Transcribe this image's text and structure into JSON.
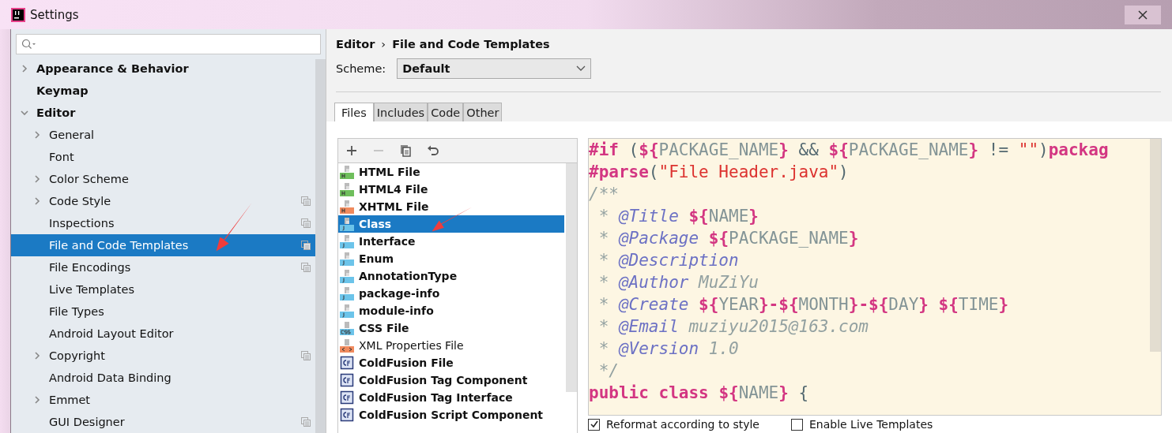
{
  "window": {
    "title": "Settings"
  },
  "sidebar": {
    "items": [
      {
        "label": "Appearance & Behavior",
        "expanded": false,
        "selected": false,
        "project_level": false
      },
      {
        "label": "Keymap",
        "selected": false,
        "project_level": false
      },
      {
        "label": "Editor",
        "expanded": true,
        "selected": false,
        "project_level": false,
        "children": [
          {
            "label": "General",
            "expanded": false,
            "selected": false,
            "project_level": false
          },
          {
            "label": "Font",
            "selected": false,
            "project_level": false
          },
          {
            "label": "Color Scheme",
            "expanded": false,
            "selected": false,
            "project_level": false
          },
          {
            "label": "Code Style",
            "expanded": false,
            "selected": false,
            "project_level": true
          },
          {
            "label": "Inspections",
            "selected": false,
            "project_level": true
          },
          {
            "label": "File and Code Templates",
            "selected": true,
            "project_level": true
          },
          {
            "label": "File Encodings",
            "selected": false,
            "project_level": true
          },
          {
            "label": "Live Templates",
            "selected": false,
            "project_level": false
          },
          {
            "label": "File Types",
            "selected": false,
            "project_level": false
          },
          {
            "label": "Android Layout Editor",
            "selected": false,
            "project_level": false
          },
          {
            "label": "Copyright",
            "expanded": false,
            "selected": false,
            "project_level": true
          },
          {
            "label": "Android Data Binding",
            "selected": false,
            "project_level": false
          },
          {
            "label": "Emmet",
            "expanded": false,
            "selected": false,
            "project_level": false
          },
          {
            "label": "GUI Designer",
            "selected": false,
            "project_level": true
          }
        ]
      }
    ]
  },
  "breadcrumb": [
    "Editor",
    "›",
    "File and Code Templates"
  ],
  "scheme": {
    "label": "Scheme:",
    "value": "Default"
  },
  "tabs": [
    {
      "label": "Files",
      "selected": true
    },
    {
      "label": "Includes",
      "selected": false
    },
    {
      "label": "Code",
      "selected": false
    },
    {
      "label": "Other",
      "selected": false
    }
  ],
  "toolbar": [
    {
      "kind": "add",
      "disabled": false
    },
    {
      "kind": "remove",
      "disabled": true
    },
    {
      "kind": "copy",
      "disabled": false
    },
    {
      "kind": "reset",
      "disabled": false
    }
  ],
  "templates": [
    {
      "name": "HTML File",
      "kind": "html",
      "customized": true,
      "selected": false
    },
    {
      "name": "HTML4 File",
      "kind": "html",
      "customized": true,
      "selected": false
    },
    {
      "name": "XHTML File",
      "kind": "xhtml",
      "customized": true,
      "selected": false
    },
    {
      "name": "Class",
      "kind": "java",
      "customized": true,
      "selected": true
    },
    {
      "name": "Interface",
      "kind": "java",
      "customized": true,
      "selected": false
    },
    {
      "name": "Enum",
      "kind": "java",
      "customized": true,
      "selected": false
    },
    {
      "name": "AnnotationType",
      "kind": "java",
      "customized": true,
      "selected": false
    },
    {
      "name": "package-info",
      "kind": "java",
      "customized": true,
      "selected": false
    },
    {
      "name": "module-info",
      "kind": "java",
      "customized": true,
      "selected": false
    },
    {
      "name": "CSS File",
      "kind": "css",
      "customized": true,
      "selected": false
    },
    {
      "name": "XML Properties File",
      "kind": "xml",
      "customized": false,
      "selected": false
    },
    {
      "name": "ColdFusion File",
      "kind": "cf",
      "customized": true,
      "selected": false
    },
    {
      "name": "ColdFusion Tag Component",
      "kind": "cf",
      "customized": true,
      "selected": false
    },
    {
      "name": "ColdFusion Tag Interface",
      "kind": "cf",
      "customized": true,
      "selected": false
    },
    {
      "name": "ColdFusion Script Component",
      "kind": "cf",
      "customized": true,
      "selected": false
    }
  ],
  "code": [
    [
      {
        "text": "#if",
        "kind": "directive"
      },
      {
        "text": " (",
        "kind": "plain"
      },
      {
        "text": "${",
        "kind": "directive"
      },
      {
        "text": "PACKAGE_NAME",
        "kind": "var"
      },
      {
        "text": "}",
        "kind": "directive"
      },
      {
        "text": " && ",
        "kind": "plain"
      },
      {
        "text": "${",
        "kind": "directive"
      },
      {
        "text": "PACKAGE_NAME",
        "kind": "var"
      },
      {
        "text": "}",
        "kind": "directive"
      },
      {
        "text": " != ",
        "kind": "plain"
      },
      {
        "text": "\"\"",
        "kind": "string"
      },
      {
        "text": ")",
        "kind": "plain"
      },
      {
        "text": "packag",
        "kind": "directive"
      }
    ],
    [
      {
        "text": "#parse",
        "kind": "directive"
      },
      {
        "text": "(",
        "kind": "plain"
      },
      {
        "text": "\"File Header.java\"",
        "kind": "string"
      },
      {
        "text": ")",
        "kind": "plain"
      }
    ],
    [
      {
        "text": "/**",
        "kind": "comment"
      }
    ],
    [
      {
        "text": " * ",
        "kind": "comment"
      },
      {
        "text": "@Title ",
        "kind": "tag"
      },
      {
        "text": "${",
        "kind": "directive"
      },
      {
        "text": "NAME",
        "kind": "var"
      },
      {
        "text": "}",
        "kind": "directive"
      }
    ],
    [
      {
        "text": " * ",
        "kind": "comment"
      },
      {
        "text": "@Package ",
        "kind": "tag"
      },
      {
        "text": "${",
        "kind": "directive"
      },
      {
        "text": "PACKAGE_NAME",
        "kind": "var"
      },
      {
        "text": "}",
        "kind": "directive"
      }
    ],
    [
      {
        "text": " * ",
        "kind": "comment"
      },
      {
        "text": "@Description",
        "kind": "tag"
      }
    ],
    [
      {
        "text": " * ",
        "kind": "comment"
      },
      {
        "text": "@Author",
        "kind": "tag"
      },
      {
        "text": " MuZiYu",
        "kind": "comment"
      }
    ],
    [
      {
        "text": " * ",
        "kind": "comment"
      },
      {
        "text": "@Create ",
        "kind": "tag"
      },
      {
        "text": "${",
        "kind": "directive"
      },
      {
        "text": "YEAR",
        "kind": "var"
      },
      {
        "text": "}-${",
        "kind": "directive"
      },
      {
        "text": "MONTH",
        "kind": "var"
      },
      {
        "text": "}-${",
        "kind": "directive"
      },
      {
        "text": "DAY",
        "kind": "var"
      },
      {
        "text": "} ${",
        "kind": "directive"
      },
      {
        "text": "TIME",
        "kind": "var"
      },
      {
        "text": "}",
        "kind": "directive"
      }
    ],
    [
      {
        "text": " * ",
        "kind": "comment"
      },
      {
        "text": "@Email",
        "kind": "tag"
      },
      {
        "text": " muziyu2015@163.com",
        "kind": "comment"
      }
    ],
    [
      {
        "text": " * ",
        "kind": "comment"
      },
      {
        "text": "@Version",
        "kind": "tag"
      },
      {
        "text": " 1.0",
        "kind": "comment"
      }
    ],
    [
      {
        "text": " */",
        "kind": "comment"
      }
    ],
    [
      {
        "text": "public class ",
        "kind": "keyword"
      },
      {
        "text": "${",
        "kind": "directive"
      },
      {
        "text": "NAME",
        "kind": "var"
      },
      {
        "text": "}",
        "kind": "directive"
      },
      {
        "text": " {",
        "kind": "plain"
      }
    ]
  ],
  "options": [
    {
      "label": "Reformat according to style",
      "checked": true
    },
    {
      "label": "Enable Live Templates",
      "checked": false
    }
  ]
}
